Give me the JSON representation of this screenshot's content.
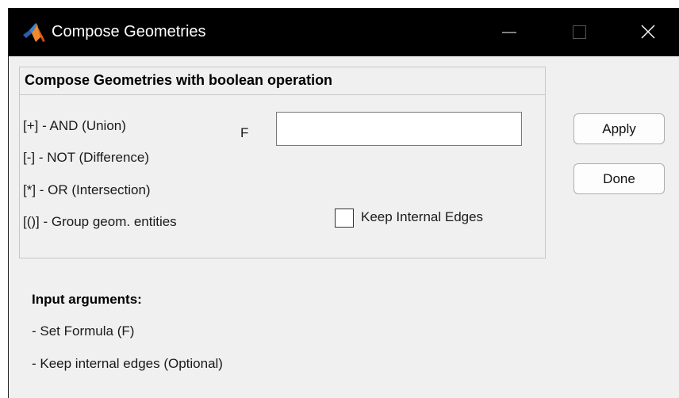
{
  "window": {
    "title": "Compose Geometries",
    "controls": {
      "minimize": "minimize-icon",
      "maximize": "maximize-icon",
      "close": "close-icon"
    },
    "app_icon": "matlab-icon"
  },
  "group": {
    "title": "Compose Geometries with boolean operation",
    "operations": [
      "[+] - AND (Union)",
      "[-] - NOT (Difference)",
      "[*] - OR (Intersection)",
      "[()] - Group geom. entities"
    ],
    "formula_label": "F",
    "formula_value": "",
    "formula_placeholder": "",
    "keep_edges_label": "Keep Internal Edges",
    "keep_edges_checked": false
  },
  "buttons": {
    "apply": "Apply",
    "done": "Done"
  },
  "help": {
    "heading": "Input arguments:",
    "items": [
      "- Set Formula (F)",
      "- Keep internal edges (Optional)"
    ]
  },
  "colors": {
    "titlebar_bg": "#000000",
    "window_bg": "#f0f0f0",
    "border": "#c8c8c8",
    "button_border": "#adadad"
  }
}
